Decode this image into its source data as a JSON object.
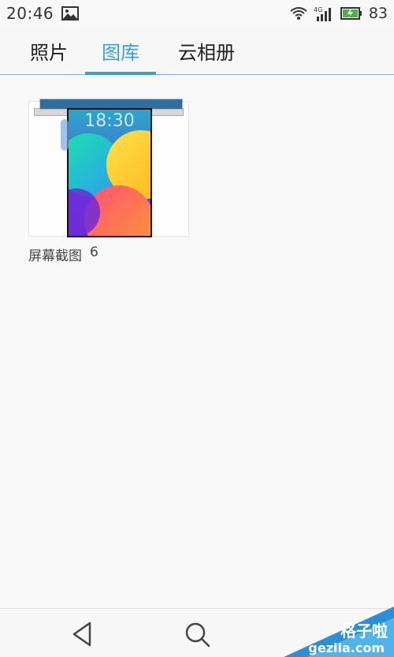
{
  "status_bar": {
    "time": "20:46",
    "network": "4G",
    "battery": "83",
    "battery_color": "#4caf50"
  },
  "tabs": [
    {
      "label": "照片",
      "active": false
    },
    {
      "label": "图库",
      "active": true
    },
    {
      "label": "云相册",
      "active": false
    }
  ],
  "accent_color": "#3d9fd1",
  "albums": [
    {
      "name": "屏幕截图",
      "count": "6",
      "thumbnail_time": "18:30"
    }
  ],
  "nav_icons": [
    "back-icon",
    "search-icon"
  ],
  "watermark": {
    "line1": "格子啦",
    "line2": "gezila.com"
  }
}
